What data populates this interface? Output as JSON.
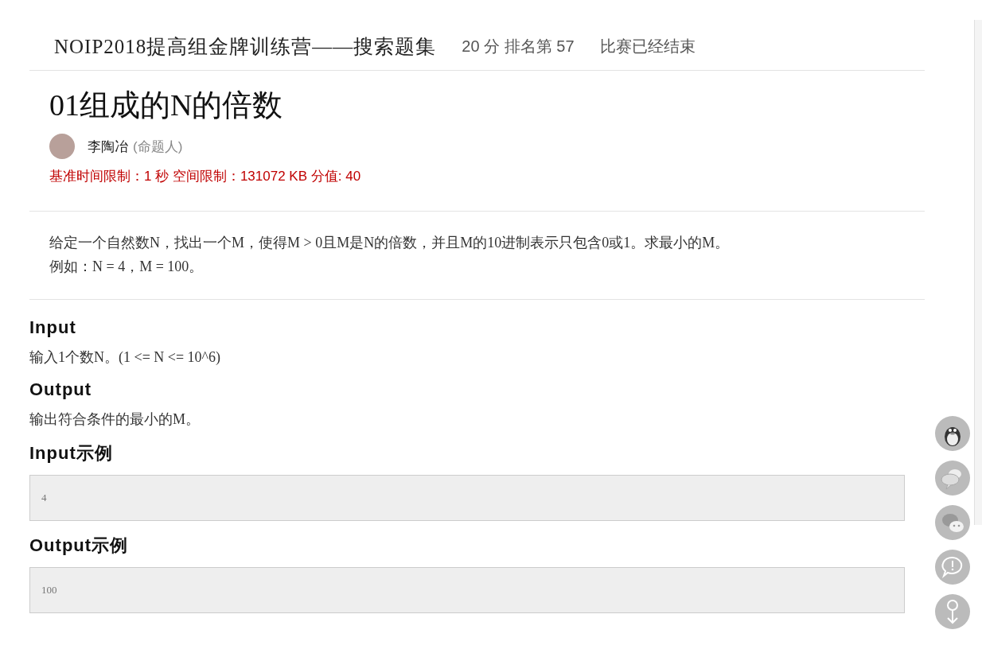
{
  "contest": {
    "title": "NOIP2018提高组金牌训练营——搜索题集",
    "score": "20 分 排名第 57",
    "status": "比赛已经结束"
  },
  "problem": {
    "title": "01组成的N的倍数",
    "author": "李陶冶",
    "author_role": "(命题人)",
    "limits": "基准时间限制：1 秒 空间限制：131072 KB 分值: 40"
  },
  "description": [
    "给定一个自然数N，找出一个M，使得M > 0且M是N的倍数，并且M的10进制表示只包含0或1。求最小的M。",
    "例如：N = 4，M = 100。"
  ],
  "sections": [
    {
      "kind": "text",
      "heading": "Input",
      "body": "输入1个数N。(1 <= N <= 10^6)"
    },
    {
      "kind": "text",
      "heading": "Output",
      "body": "输出符合条件的最小的M。"
    },
    {
      "kind": "sample",
      "heading": "Input示例",
      "body": "4"
    },
    {
      "kind": "sample",
      "heading": "Output示例",
      "body": "100"
    }
  ]
}
